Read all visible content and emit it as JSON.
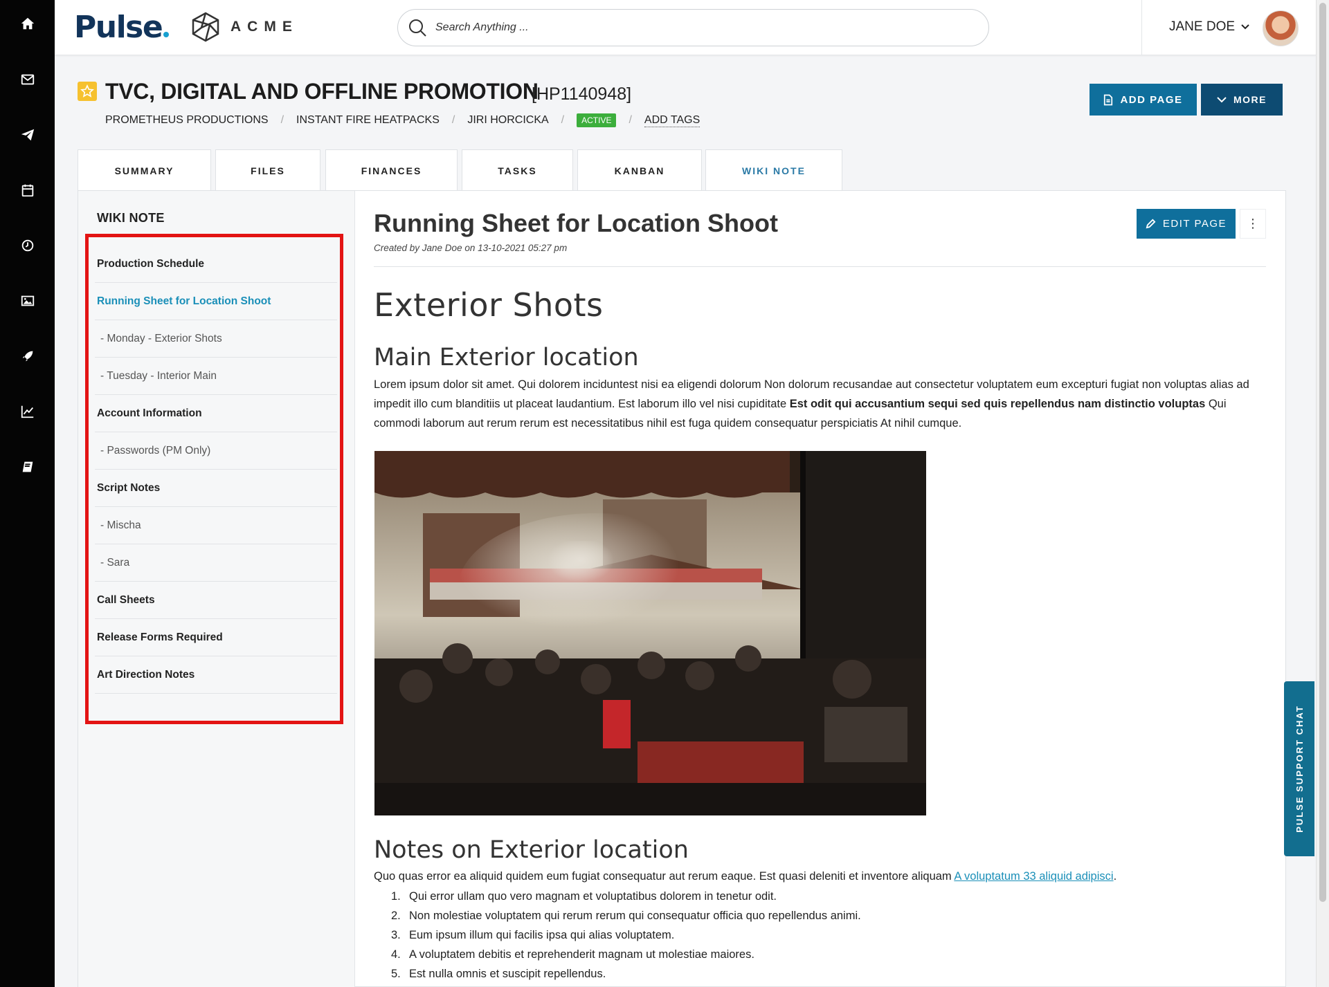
{
  "header": {
    "logo": "Pulse",
    "company": "ACME",
    "search_placeholder": "Search Anything ...",
    "user_name": "JANE DOE"
  },
  "project": {
    "title": "TVC, DIGITAL AND OFFLINE PROMOTION",
    "code": "[HP1140948]",
    "client": "PROMETHEUS PRODUCTIONS",
    "product": "INSTANT FIRE HEATPACKS",
    "manager": "JIRI HORCICKA",
    "status": "ACTIVE",
    "add_tags": "ADD TAGS",
    "add_page": "ADD PAGE",
    "more": "MORE"
  },
  "tabs": [
    "SUMMARY",
    "FILES",
    "FINANCES",
    "TASKS",
    "KANBAN",
    "WIKI NOTE"
  ],
  "sidebar": {
    "title": "WIKI NOTE",
    "items": [
      {
        "label": "Production Schedule",
        "type": "parent"
      },
      {
        "label": "Running Sheet for Location Shoot",
        "type": "parent current"
      },
      {
        "label": "- Monday - Exterior Shots",
        "type": "child"
      },
      {
        "label": "- Tuesday - Interior Main",
        "type": "child"
      },
      {
        "label": "Account Information",
        "type": "parent"
      },
      {
        "label": "- Passwords (PM Only)",
        "type": "child"
      },
      {
        "label": "Script Notes",
        "type": "parent"
      },
      {
        "label": "- Mischa",
        "type": "child"
      },
      {
        "label": "- Sara",
        "type": "child"
      },
      {
        "label": "Call Sheets",
        "type": "parent"
      },
      {
        "label": "Release Forms Required",
        "type": "parent"
      },
      {
        "label": "Art Direction Notes",
        "type": "parent"
      }
    ]
  },
  "content": {
    "title": "Running Sheet for Location Shoot",
    "meta": "Created by Jane Doe on 13-10-2021 05:27 pm",
    "edit_page": "EDIT PAGE",
    "h1": "Exterior Shots",
    "h2_main": "Main Exterior location",
    "para1_a": "Lorem ipsum dolor sit amet. Qui dolorem inciduntest nisi ea eligendi dolorum Non dolorum recusandae aut consectetur voluptatem eum excepturi fugiat non voluptas alias ad impedit illo cum blanditiis ut placeat laudantium. Est laborum illo vel nisi cupiditate ",
    "para1_bold": "Est odit qui accusantium sequi sed quis repellendus nam distinctio voluptas",
    "para1_b": " Qui commodi laborum aut rerum rerum est necessitatibus nihil est fuga quidem consequatur perspiciatis At nihil cumque.",
    "h2_notes": "Notes on Exterior location",
    "para2": "Quo quas error ea aliquid quidem eum fugiat consequatur aut rerum eaque. Est quasi deleniti et inventore aliquam ",
    "para2_link": "A voluptatum 33 aliquid adipisci",
    "para2_end": ".",
    "list": [
      {
        "n": "1.",
        "text": "Qui error ullam quo vero magnam et voluptatibus dolorem in tenetur odit."
      },
      {
        "n": "2.",
        "text": "Non molestiae voluptatem qui rerum rerum qui consequatur officia quo repellendus animi."
      },
      {
        "n": "3.",
        "text": "Eum ipsum illum qui facilis ipsa qui alias voluptatem."
      },
      {
        "n": "4.",
        "text": "A voluptatem debitis et reprehenderit magnam ut molestiae maiores."
      },
      {
        "n": "5.",
        "text": "Est nulla omnis et suscipit repellendus."
      }
    ]
  },
  "support_chat": "PULSE SUPPORT CHAT",
  "colors": {
    "primary": "#0f6f9c",
    "dark": "#0d4b72",
    "active_badge": "#3cae3c",
    "link": "#1a8fb8",
    "highlight": "#e31414"
  }
}
